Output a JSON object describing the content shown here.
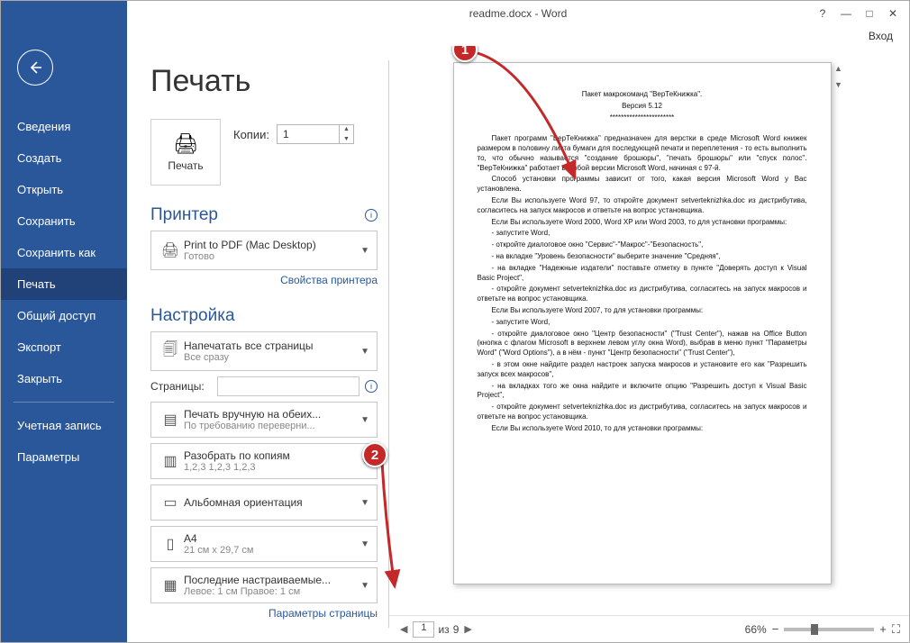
{
  "window": {
    "title": "readme.docx - Word",
    "signin": "Вход"
  },
  "sidebar": {
    "items": [
      "Сведения",
      "Создать",
      "Открыть",
      "Сохранить",
      "Сохранить как",
      "Печать",
      "Общий доступ",
      "Экспорт",
      "Закрыть"
    ],
    "footer": [
      "Учетная запись",
      "Параметры"
    ],
    "active": "Печать"
  },
  "print": {
    "title": "Печать",
    "button": "Печать",
    "copies_label": "Копии:",
    "copies_value": "1",
    "printer_heading": "Принтер",
    "printer_name": "Print to PDF (Mac Desktop)",
    "printer_status": "Готово",
    "printer_props": "Свойства принтера",
    "settings_heading": "Настройка",
    "opt_pages": {
      "l1": "Напечатать все страницы",
      "l2": "Все сразу"
    },
    "pages_label": "Страницы:",
    "opt_duplex": {
      "l1": "Печать вручную на обеих...",
      "l2": "По требованию переверни..."
    },
    "opt_collate": {
      "l1": "Разобрать по копиям",
      "l2": "1,2,3   1,2,3   1,2,3"
    },
    "opt_orient": {
      "l1": "Альбомная ориентация",
      "l2": ""
    },
    "opt_paper": {
      "l1": "A4",
      "l2": "21 см x 29,7 см"
    },
    "opt_margins": {
      "l1": "Последние настраиваемые...",
      "l2": "Левое: 1 см   Правое: 1 см"
    },
    "page_setup": "Параметры страницы"
  },
  "preview": {
    "page_current": "1",
    "page_sep": "из",
    "page_total": "9",
    "zoom": "66%",
    "doc_lines": [
      "Пакет макрокоманд \"ВерТеКнижка\".",
      "Версия 5.12",
      "***********************",
      "Пакет программ \"ВерТеКнижка\" предназначен для верстки в среде Microsoft Word книжек размером в половину листа бумаги для последующей печати и переплетения - то есть выполнить то, что обычно называется \"создание брошюры\", \"печать брошюры\" или \"спуск полос\". \"ВерТеКнижка\" работает в любой версии Microsoft Word, начиная с 97-й.",
      "Способ установки программы зависит от того, какая версия Microsoft Word у Вас установлена.",
      "Если Вы используете Word 97, то откройте документ setverteknizhka.doc из дистрибутива, согласитесь на запуск макросов и ответьте на вопрос установщика.",
      "Если Вы используете Word 2000, Word XP или Word 2003, то для установки программы:",
      "- запустите Word,",
      "- откройте диалоговое окно \"Сервис\"-\"Макрос\"-\"Безопасность\",",
      "- на вкладке \"Уровень безопасности\" выберите значение \"Средняя\",",
      "- на вкладке \"Надежные издатели\" поставьте отметку в пункте \"Доверять доступ к Visual Basic Project\",",
      "- откройте документ setverteknizhka.doc из дистрибутива, согласитесь на запуск макросов и ответьте на вопрос установщика.",
      "Если Вы используете Word 2007, то для установки программы:",
      "- запустите Word,",
      "- откройте диалоговое окно \"Центр безопасности\" (\"Trust Center\"), нажав на Office Button (кнопка с флагом Microsoft в верхнем левом углу окна Word), выбрав в меню пункт \"Параметры Word\" (\"Word Options\"), а в нём - пункт \"Центр безопасности\" (\"Trust Center\"),",
      "- в этом окне найдите раздел настроек запуска макросов и установите его как \"Разрешить запуск всех макросов\",",
      "- на вкладках того же окна найдите и включите опцию \"Разрешить доступ к Visual Basic Project\",",
      "- откройте документ setverteknizhka.doc из дистрибутива, согласитесь на запуск макросов и ответьте на вопрос установщика.",
      "Если Вы используете Word 2010, то для установки программы:"
    ]
  },
  "callouts": {
    "c1": "1",
    "c2": "2"
  }
}
